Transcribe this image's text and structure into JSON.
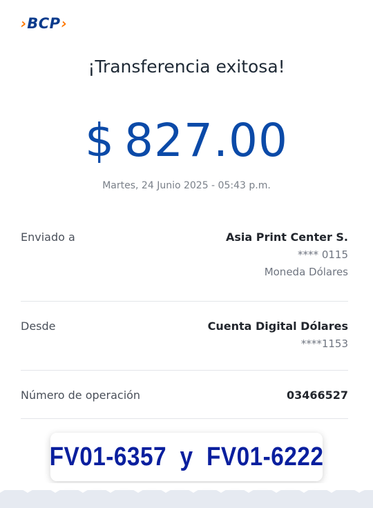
{
  "brand": {
    "name": "BCP",
    "chevron_left": "›",
    "chevron_right": "›",
    "accent_color": "#ff7800",
    "brand_color": "#0a3b8c"
  },
  "title": "¡Transferencia exitosa!",
  "amount": {
    "currency": "$",
    "value": "827.00",
    "color": "#0b4aa8"
  },
  "date": "Martes, 24 Junio 2025 - 05:43 p.m.",
  "sent_to": {
    "label": "Enviado a",
    "name": "Asia Print Center S.",
    "account": "**** 0115",
    "currency": "Moneda Dólares"
  },
  "from": {
    "label": "Desde",
    "name": "Cuenta Digital Dólares",
    "account": "****1153"
  },
  "operation": {
    "label": "Número de operación",
    "number": "03466527"
  },
  "note": "FV01-6357  y  FV01-6222"
}
